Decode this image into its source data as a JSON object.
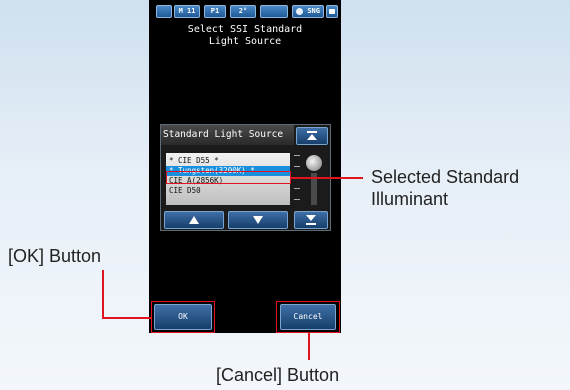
{
  "status_bar": {
    "mode": "M 11",
    "preset": "P1",
    "angle": "2°",
    "function": "SNG"
  },
  "screen_title": {
    "line1": "Select SSI Standard",
    "line2": "Light Source"
  },
  "dialog": {
    "header": "Standard Light Source",
    "items": [
      {
        "label": "* CIE D55 *",
        "selected": false
      },
      {
        "label": "* Tungsten(3200K) *",
        "selected": true
      },
      {
        "label": "CIE A(2856K)",
        "selected": false
      },
      {
        "label": "CIE D50",
        "selected": false
      }
    ]
  },
  "buttons": {
    "ok": "OK",
    "cancel": "Cancel"
  },
  "callouts": {
    "selected_line1": "Selected Standard",
    "selected_line2": "Illuminant",
    "ok": "[OK] Button",
    "cancel": "[Cancel] Button"
  },
  "colors": {
    "highlight": "#e0141f",
    "selection": "#1a8fde",
    "button": "#1f5a99"
  },
  "icons": {
    "nav_top": "scroll-to-top-icon",
    "nav_up": "scroll-up-icon",
    "nav_down": "scroll-down-icon",
    "nav_bottom": "scroll-to-bottom-icon",
    "battery": "battery-icon"
  }
}
